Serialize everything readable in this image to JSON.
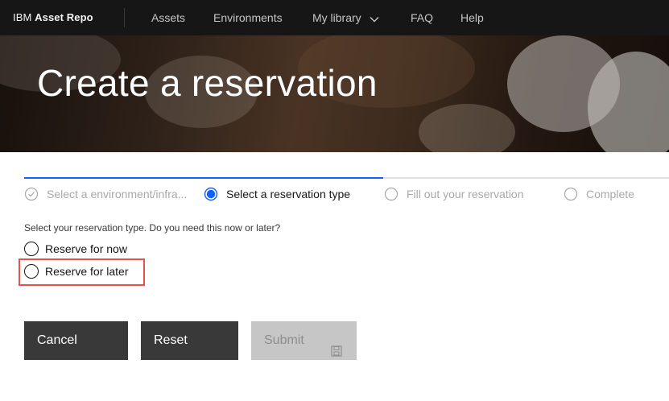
{
  "header": {
    "brand_prefix": "IBM",
    "brand_name": "Asset Repo",
    "nav": [
      {
        "label": "Assets"
      },
      {
        "label": "Environments"
      },
      {
        "label": "My library"
      },
      {
        "label": "FAQ"
      },
      {
        "label": "Help"
      }
    ]
  },
  "hero": {
    "title": "Create a reservation"
  },
  "progress": {
    "steps": [
      {
        "label": "Select a environment/infra...",
        "state": "complete"
      },
      {
        "label": "Select a reservation type",
        "state": "current"
      },
      {
        "label": "Fill out your reservation",
        "state": "incomplete"
      },
      {
        "label": "Complete",
        "state": "incomplete"
      }
    ]
  },
  "form": {
    "prompt": "Select your reservation type. Do you need this now or later?",
    "options": [
      {
        "label": "Reserve for now",
        "checked": false
      },
      {
        "label": "Reserve for later",
        "checked": false
      }
    ]
  },
  "actions": {
    "cancel_label": "Cancel",
    "reset_label": "Reset",
    "submit_label": "Submit"
  },
  "colors": {
    "accent": "#0f62fe",
    "header_bg": "#161616",
    "button_dark": "#393939",
    "button_disabled": "#c6c6c6",
    "highlight": "#e5524d"
  },
  "icons": {
    "complete_step": "checkmark-outline-icon",
    "current_step": "radio-filled-icon",
    "incomplete_step": "circle-outline-icon",
    "submit": "save-icon",
    "nav_dropdown": "chevron-down-icon"
  }
}
